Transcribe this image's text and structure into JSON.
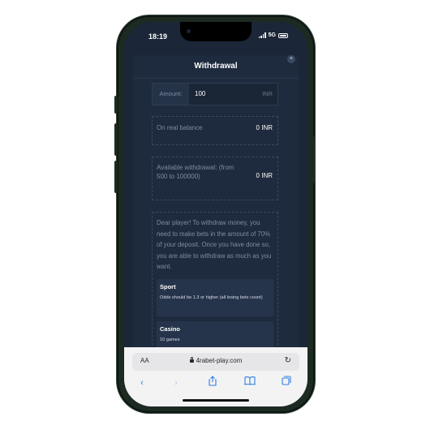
{
  "status": {
    "time": "18:19",
    "network": "5G"
  },
  "modal": {
    "title": "Withdrawal",
    "close_glyph": "×",
    "amount": {
      "label": "Amount:",
      "value": "100",
      "currency": "INR"
    },
    "real_balance": {
      "label": "On real balance",
      "value": "0 INR"
    },
    "available": {
      "label": "Available withdrawal: (from 500 to 100000)",
      "value": "0 INR"
    },
    "info": {
      "text": "Dear player! To withdraw money, you need to make bets in the amount of 70% of your deposit. Once you have done so, you are able to withdraw as much as you want.",
      "sport_title": "Sport",
      "sport_text": "Odds should be 1.3 or higher (all losing bets count)",
      "casino_title": "Casino",
      "casino_text": "10 games"
    }
  },
  "browser": {
    "aa_label": "AA",
    "url": "4rabet-play.com",
    "icons": [
      "lock-icon",
      "reload-icon",
      "back-icon",
      "forward-icon",
      "share-icon",
      "bookmarks-icon",
      "tabs-icon"
    ]
  },
  "colors": {
    "modal_bg": "#1e2a3d",
    "screen_bg": "#1b2638",
    "accent": "#2f7de1"
  }
}
